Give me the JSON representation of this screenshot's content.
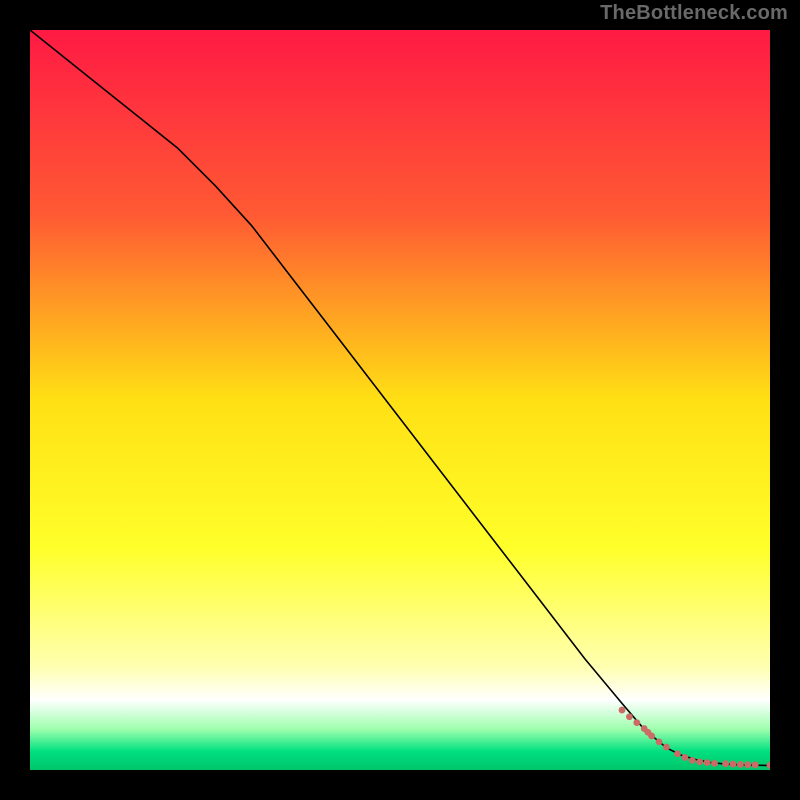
{
  "attribution": "TheBottleneck.com",
  "chart_data": {
    "type": "line",
    "title": "",
    "xlabel": "",
    "ylabel": "",
    "xlim": [
      0,
      100
    ],
    "ylim": [
      0,
      100
    ],
    "background_gradient": {
      "stops": [
        {
          "offset": 0.0,
          "color": "#ff1a44"
        },
        {
          "offset": 0.25,
          "color": "#ff5a33"
        },
        {
          "offset": 0.5,
          "color": "#ffe014"
        },
        {
          "offset": 0.7,
          "color": "#ffff2a"
        },
        {
          "offset": 0.86,
          "color": "#ffffb0"
        },
        {
          "offset": 0.905,
          "color": "#ffffff"
        },
        {
          "offset": 0.945,
          "color": "#9dffad"
        },
        {
          "offset": 0.975,
          "color": "#00e080"
        },
        {
          "offset": 1.0,
          "color": "#00c46a"
        }
      ]
    },
    "series": [
      {
        "name": "bottleneck-curve",
        "color": "#000000",
        "stroke_width": 1.6,
        "x": [
          0,
          5,
          10,
          15,
          20,
          25,
          30,
          35,
          40,
          45,
          50,
          55,
          60,
          65,
          70,
          75,
          80,
          83,
          86,
          88,
          90,
          92,
          94,
          96,
          98,
          100
        ],
        "y": [
          100,
          96,
          92,
          88,
          84,
          79,
          73.5,
          67,
          60.5,
          54,
          47.5,
          41,
          34.5,
          28,
          21.5,
          15,
          9,
          5.5,
          3,
          2,
          1.4,
          1.0,
          0.8,
          0.7,
          0.65,
          0.6
        ]
      }
    ],
    "scatter": {
      "name": "sample-points",
      "color": "#cc6b66",
      "radius": 3.4,
      "x": [
        80,
        81,
        82,
        83,
        83.5,
        84,
        85,
        86,
        87.5,
        88.5,
        89.5,
        90.5,
        91.5,
        92.5,
        94,
        95,
        96,
        97,
        98,
        100
      ],
      "y": [
        8.1,
        7.2,
        6.4,
        5.6,
        5.1,
        4.6,
        3.8,
        3.1,
        2.2,
        1.7,
        1.3,
        1.1,
        1.0,
        0.9,
        0.85,
        0.8,
        0.75,
        0.72,
        0.7,
        0.65
      ]
    }
  }
}
